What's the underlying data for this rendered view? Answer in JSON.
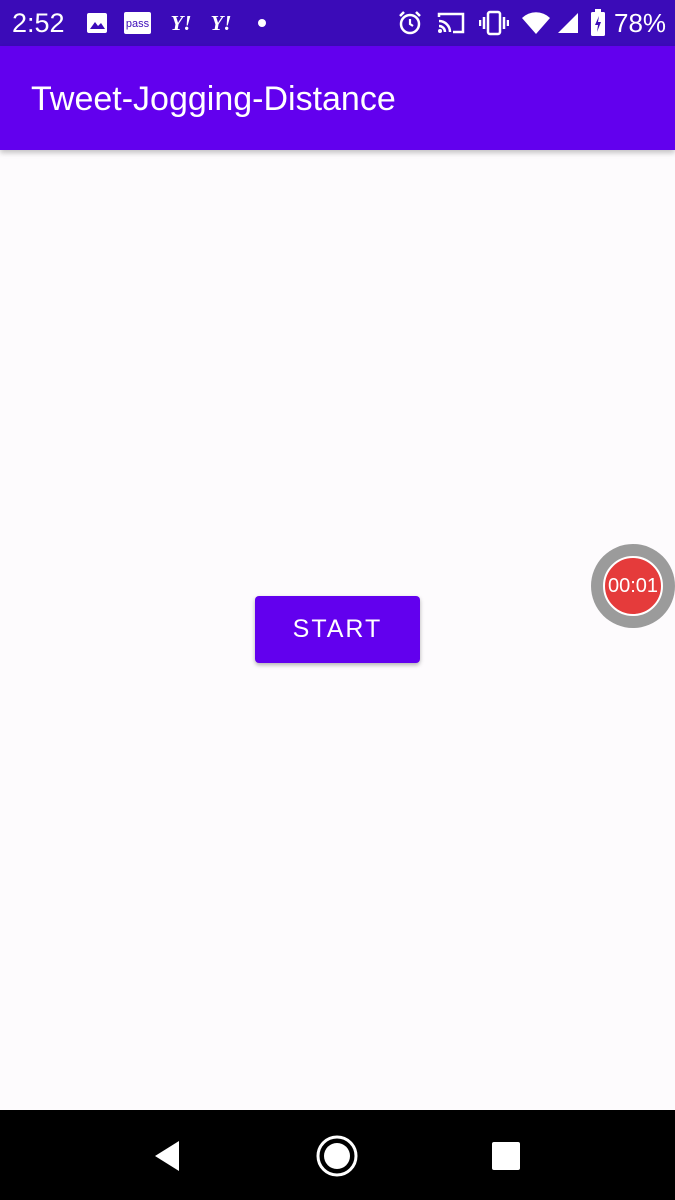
{
  "status_bar": {
    "time": "2:52",
    "battery_percent": "78%",
    "icons": [
      "image-icon",
      "pass-icon",
      "yahoo-icon",
      "yahoo-icon",
      "dot-icon",
      "alarm-icon",
      "cast-icon",
      "vibrate-icon",
      "wifi-icon",
      "signal-icon",
      "battery-icon"
    ],
    "pass_label": "pass",
    "yahoo_label": "Y!"
  },
  "app_bar": {
    "title": "Tweet-Jogging-Distance"
  },
  "main": {
    "start_label": "START"
  },
  "recorder": {
    "elapsed": "00:01"
  },
  "nav_bar": {
    "icons": [
      "back-icon",
      "home-icon",
      "recents-icon"
    ]
  },
  "colors": {
    "status_bar": "#3b0bb8",
    "app_bar": "#6200ee",
    "primary": "#6200ee",
    "background": "#fdfbfd",
    "recorder_outer": "#9b9b9b",
    "recorder_inner": "#e53b3b"
  }
}
